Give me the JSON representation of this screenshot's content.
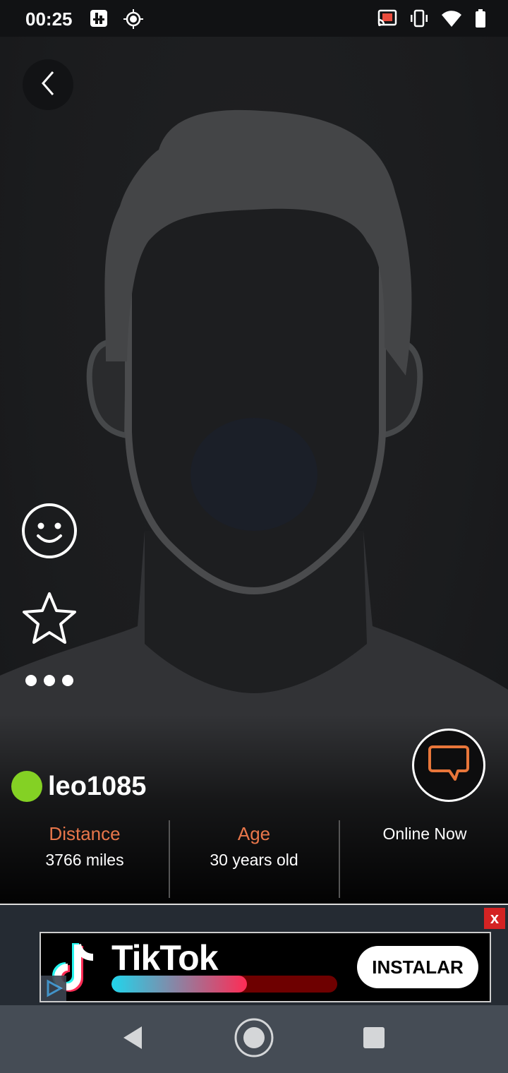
{
  "status_bar": {
    "time": "00:25",
    "left_icons": [
      "app-notification-icon",
      "location-target-icon"
    ],
    "right_icons": [
      "cast-icon",
      "vibrate-icon",
      "wifi-icon",
      "battery-icon"
    ]
  },
  "profile": {
    "back_icon": "chevron-left-icon",
    "username": "leo1085",
    "online": true,
    "online_color": "#84d124",
    "stats": {
      "distance_label": "Distance",
      "distance_value": "3766 miles",
      "age_label": "Age",
      "age_value": "30 years old",
      "status": "Online Now"
    },
    "side_actions": [
      "smile-icon",
      "star-icon",
      "more-icon"
    ],
    "accent_color": "#e8764a"
  },
  "ad": {
    "close_label": "x",
    "brand": "TikTok",
    "cta": "INSTALAR",
    "progress": 0.6
  },
  "nav": {
    "buttons": [
      "back-icon",
      "home-icon",
      "recents-icon"
    ]
  }
}
